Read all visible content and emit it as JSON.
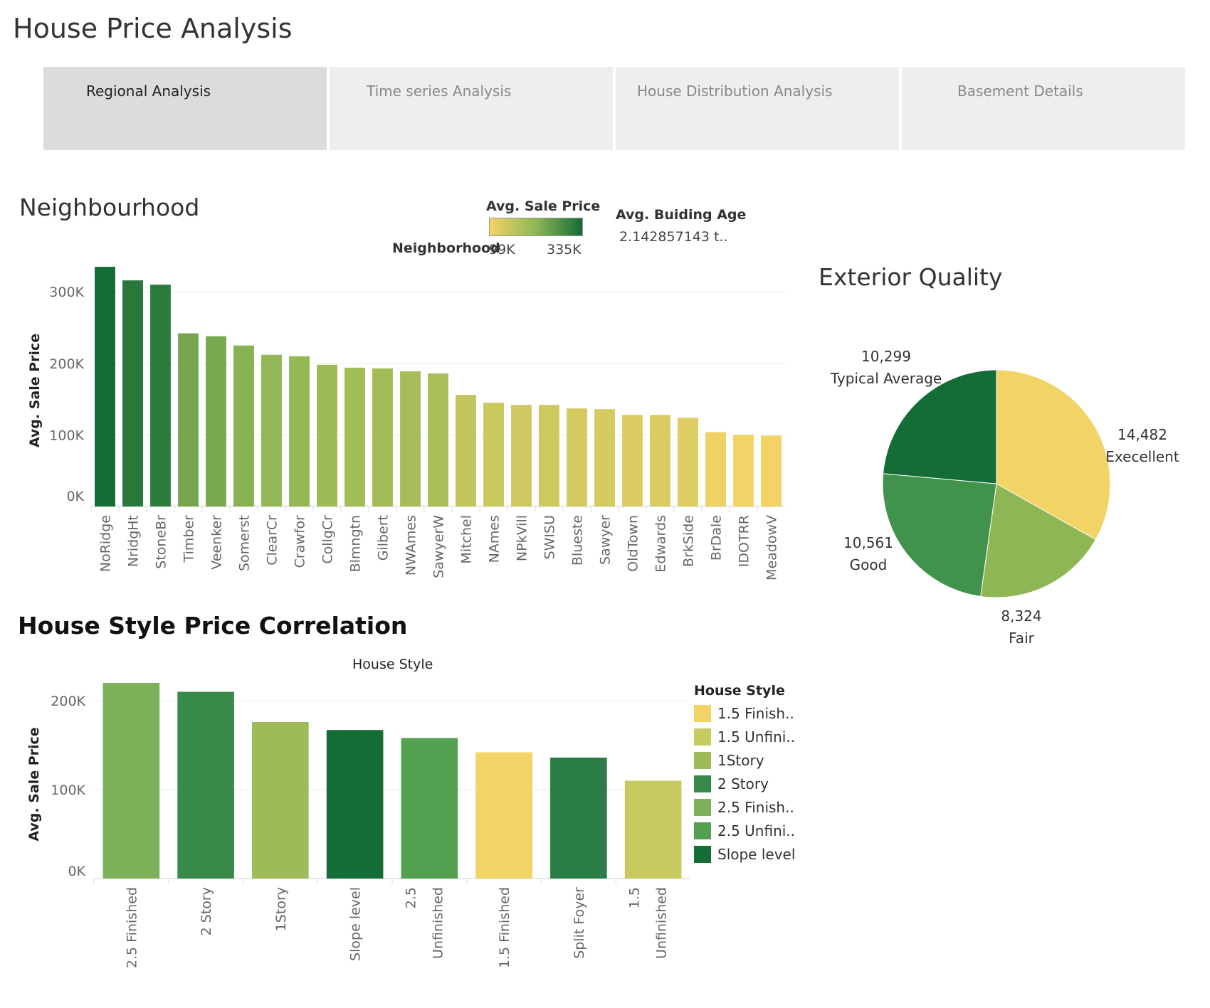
{
  "dashboard": {
    "title": "House Price Analysis",
    "tabs": [
      {
        "label": "Regional Analysis",
        "active": true
      },
      {
        "label": "Time series Analysis",
        "active": false
      },
      {
        "label": "House Distribution Analysis",
        "active": false
      },
      {
        "label": "Basement Details",
        "active": false
      }
    ]
  },
  "neighbourhood": {
    "title": "Neighbourhood",
    "color_legend": {
      "title": "Avg. Sale Price",
      "min_label": "99K",
      "max_label": "335K",
      "low_color": "#f2d366",
      "high_color": "#146c36"
    },
    "row_label": "Neighborhood",
    "age_legend": {
      "title": "Avg. Buiding Age",
      "value": "2.142857143 t.."
    }
  },
  "exterior": {
    "title": "Exterior Quality"
  },
  "house_style": {
    "title": "House Style Price Correlation",
    "top_header": "House Style"
  },
  "chart_data": [
    {
      "type": "bar",
      "ylabel": "Avg. Sale Price",
      "ylim": [
        0,
        340000
      ],
      "yticks": [
        "0K",
        "100K",
        "200K",
        "300K"
      ],
      "ytick_values": [
        0,
        100000,
        200000,
        300000
      ],
      "grid": true,
      "categories": [
        "NoRidge",
        "NridgHt",
        "StoneBr",
        "Timber",
        "Veenker",
        "Somerst",
        "ClearCr",
        "Crawfor",
        "CollgCr",
        "Blmngtn",
        "Gilbert",
        "NWAmes",
        "SawyerW",
        "Mitchel",
        "NAmes",
        "NPkVill",
        "SWISU",
        "Blueste",
        "Sawyer",
        "OldTown",
        "Edwards",
        "BrkSide",
        "BrDale",
        "IDOTRR",
        "MeadowV"
      ],
      "values": [
        335000,
        316000,
        310000,
        242000,
        238000,
        225000,
        212000,
        210000,
        198000,
        194000,
        193000,
        189000,
        186000,
        156000,
        145000,
        142000,
        142000,
        137000,
        136000,
        128000,
        128000,
        124000,
        104000,
        100000,
        99000
      ]
    },
    {
      "type": "pie",
      "slices": [
        {
          "label": "Execellent",
          "value": 14482,
          "value_label": "14,482",
          "color": "#f2d366"
        },
        {
          "label": "Fair",
          "value": 8324,
          "value_label": "8,324",
          "color": "#8fb655"
        },
        {
          "label": "Good",
          "value": 10561,
          "value_label": "10,561",
          "color": "#41924d"
        },
        {
          "label": "Typical Average",
          "value": 10299,
          "value_label": "10,299",
          "color": "#146c36"
        }
      ]
    },
    {
      "type": "bar",
      "ylabel": "Avg. Sale Price",
      "ylim": [
        0,
        220000
      ],
      "yticks": [
        "0K",
        "100K",
        "200K"
      ],
      "ytick_values": [
        0,
        100000,
        200000
      ],
      "grid": true,
      "categories": [
        "2.5 Finished",
        "2 Story",
        "1Story",
        "Slope level",
        "2.5 Unfinished",
        "1.5 Finished",
        "Split Foyer",
        "1.5 Unfinished"
      ],
      "category_lines": [
        [
          "2.5 Finished"
        ],
        [
          "2 Story"
        ],
        [
          "1Story"
        ],
        [
          "Slope level"
        ],
        [
          "2.5",
          "Unfinished"
        ],
        [
          "1.5 Finished"
        ],
        [
          "Split Foyer"
        ],
        [
          "1.5",
          "Unfinished"
        ]
      ],
      "values": [
        220000,
        210000,
        176000,
        167000,
        158000,
        142000,
        136000,
        110000
      ],
      "colors": [
        "#7cb15a",
        "#388a49",
        "#9dbb58",
        "#146c36",
        "#53a050",
        "#f2d366",
        "#2a7d45",
        "#c8c95e"
      ],
      "legend": {
        "title": "House Style",
        "items": [
          {
            "label": "1.5 Finish..",
            "color": "#f2d366"
          },
          {
            "label": "1.5 Unfini..",
            "color": "#c8c95e"
          },
          {
            "label": "1Story",
            "color": "#9dbb58"
          },
          {
            "label": "2 Story",
            "color": "#388a49"
          },
          {
            "label": "2.5 Finish..",
            "color": "#7cb15a"
          },
          {
            "label": "2.5 Unfini..",
            "color": "#53a050"
          },
          {
            "label": "Slope level",
            "color": "#146c36"
          }
        ]
      }
    }
  ]
}
